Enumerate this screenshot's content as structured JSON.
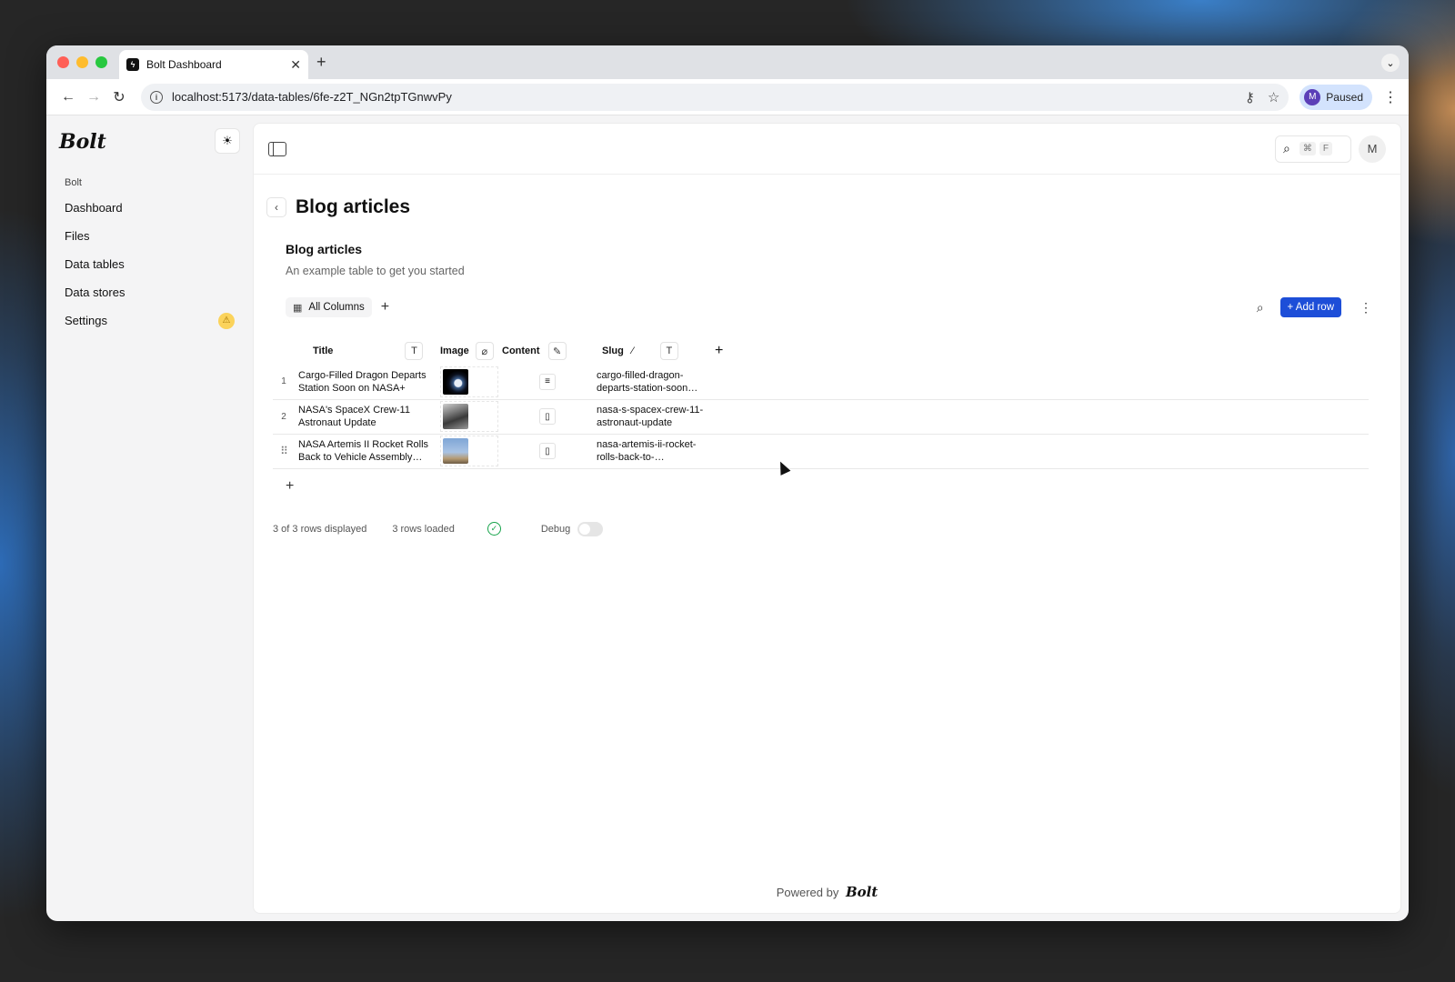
{
  "browser": {
    "tab_title": "Bolt Dashboard",
    "tab_favicon": "bolt-favicon",
    "url": "localhost:5173/data-tables/6fe-z2T_NGn2tpTGnwvPy",
    "profile_initial": "M",
    "profile_status": "Paused"
  },
  "sidebar": {
    "logo": "Bolt",
    "section": "Bolt",
    "items": [
      {
        "label": "Dashboard"
      },
      {
        "label": "Files"
      },
      {
        "label": "Data tables"
      },
      {
        "label": "Data stores"
      },
      {
        "label": "Settings",
        "badge": "warning-icon"
      }
    ]
  },
  "topbar": {
    "shortcut_cmd": "⌘",
    "shortcut_key": "F",
    "avatar": "M"
  },
  "page": {
    "title": "Blog articles",
    "table_title": "Blog articles",
    "table_description": "An example table to get you started",
    "view_label": "All Columns",
    "add_row_label": "+ Add row"
  },
  "table": {
    "columns": [
      {
        "label": "Title",
        "type_icon": "text-icon"
      },
      {
        "label": "Image",
        "type_icon": "attachment-icon"
      },
      {
        "label": "Content",
        "type_icon": "edit-icon"
      },
      {
        "label": "Slug",
        "type_icon": "magic-wand-icon",
        "extra_icon": "text-icon"
      }
    ],
    "rows": [
      {
        "num": "1",
        "title": "Cargo-Filled Dragon Departs Station Soon on NASA+",
        "slug": "cargo-filled-dragon-departs-station-soon…",
        "content_icon": "document-lines-icon"
      },
      {
        "num": "2",
        "title": "NASA's SpaceX Crew-11 Astronaut Update",
        "slug": "nasa-s-spacex-crew-11-astronaut-update",
        "content_icon": "document-icon"
      },
      {
        "num": "",
        "title": "NASA Artemis II Rocket Rolls Back to Vehicle Assembly…",
        "slug": "nasa-artemis-ii-rocket-rolls-back-to-…",
        "content_icon": "document-icon"
      }
    ]
  },
  "status": {
    "displayed": "3 of 3 rows displayed",
    "loaded": "3 rows loaded",
    "debug_label": "Debug"
  },
  "footer": {
    "powered_by": "Powered by",
    "logo": "Bolt"
  },
  "colors": {
    "accent": "#1d4ed8",
    "success": "#16a34a",
    "warning": "#fbd35b"
  }
}
